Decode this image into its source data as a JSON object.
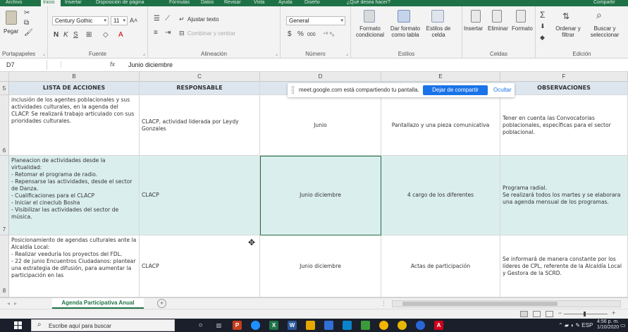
{
  "ribbon": {
    "tabs": [
      {
        "label": "Archivo",
        "active": false
      },
      {
        "label": "Inicio",
        "active": true
      },
      {
        "label": "Insertar",
        "active": false
      },
      {
        "label": "Disposición de página",
        "active": false
      },
      {
        "label": "Fórmulas",
        "active": false
      },
      {
        "label": "Datos",
        "active": false
      },
      {
        "label": "Revisar",
        "active": false
      },
      {
        "label": "Vista",
        "active": false
      },
      {
        "label": "Ayuda",
        "active": false
      },
      {
        "label": "Diseño",
        "active": false
      },
      {
        "label": "¿Qué desea hacer?",
        "active": false
      },
      {
        "label": "Compartir",
        "active": false
      }
    ],
    "clipboard": {
      "paste_label": "Pegar",
      "group_label": "Portapapeles"
    },
    "font": {
      "name": "Century Gothic",
      "size": "11",
      "bold": "N",
      "italic": "K",
      "underline": "S",
      "group_label": "Fuente"
    },
    "alignment": {
      "wrap_label": "Ajustar texto",
      "merge_label": "Combinar y centrar",
      "group_label": "Alineación"
    },
    "number": {
      "format": "General",
      "currency": "$",
      "percent": "%",
      "thousands": "000",
      "group_label": "Número"
    },
    "styles": {
      "conditional_label": "Formato condicional",
      "table_label": "Dar formato como tabla",
      "cell_styles_label": "Estilos de celda",
      "group_label": "Estilos"
    },
    "cells": {
      "insert_label": "Insertar",
      "delete_label": "Eliminar",
      "format_label": "Formato",
      "group_label": "Celdas"
    },
    "editing": {
      "sort_label": "Ordenar y filtrar",
      "find_label": "Buscar y seleccionar",
      "group_label": "Edición"
    },
    "colors": {
      "excel_green": "#1f7246",
      "ribbon_bg": "#f3f3f3"
    }
  },
  "formula_bar": {
    "name_box": "D7",
    "fx": "fx",
    "content": "Junio diciembre"
  },
  "grid": {
    "columns": [
      "B",
      "C",
      "D",
      "E",
      "F"
    ],
    "header_row": {
      "row_number": "5",
      "acciones": "LISTA DE ACCIONES",
      "responsable": "RESPONSABLE",
      "fecha": "",
      "producto": "",
      "observaciones": "OBSERVACIONES"
    },
    "rows": [
      {
        "row_number": "6",
        "acciones": "inclusión de los agentes poblacionales y sus actividades culturales, en la agenda del CLACP. Se realizará trabajo articulado con sus prioridades culturales.",
        "responsable": "CLACP, actividad liderada por Leydy Gonzales",
        "fecha": "Junio",
        "producto": "Pantallazo y una pieza comunicativa",
        "observaciones": "Tener en cuenta las Convocatorias poblacionales, específicas para el sector poblacional."
      },
      {
        "row_number": "7",
        "acciones": "Planeacion de actividades desde la virtualidad:\n- Retomar el programa de radio.\n- Repensarse las actividades, desde el sector de Danza.\n- Cualificaciones para el CLACP\n- Iniciar el cineclub Bosha\n- Visibilizar las actividades del sector de música.",
        "responsable": "CLACP",
        "fecha": "Junio diciembre",
        "producto": "4 cargo de los diferentes",
        "observaciones": "Programa radial.\nSe realizará todos los martes y se elaborara una agenda mensual de los programas."
      },
      {
        "row_number": "8",
        "acciones": "Posicionamiento de agendas culturales ante la Alcaldía Local:\n- Realizar veeduría los proyectos del FDL.\n- 22 de junio Encuentros Ciudadanos: plantear una estrategia de difusión, para aumentar la participación en las",
        "responsable": "CLACP",
        "fecha": "Junio diciembre",
        "producto": "Actas de participación",
        "observaciones": "Se informará de manera constante por los líderes de CPL, referente de la Alcaldía Local y Gestora de la SCRD."
      }
    ],
    "teal_fill": "#dbeeee",
    "header_fill": "#dde6ef"
  },
  "share_banner": {
    "message": "meet.google.com está compartiendo tu pantalla.",
    "stop_label": "Dejar de compartir",
    "hide_label": "Ocultar",
    "button_color": "#1a73e8"
  },
  "sheets": {
    "active_tab": "Agenda Participativa Anual",
    "add_symbol": "+"
  },
  "taskbar": {
    "search_placeholder": "Escribe aquí para buscar",
    "tray_lang": "ESP",
    "clock_time": "4:56 p. m.",
    "clock_date": "1/10/2020"
  }
}
